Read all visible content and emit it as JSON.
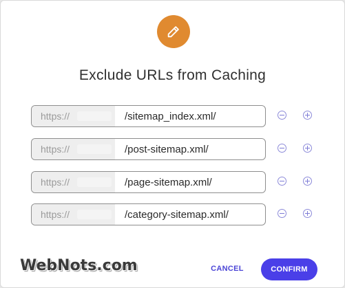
{
  "dialog": {
    "icon": "pencil-icon",
    "accent_color": "#e08a30",
    "title": "Exclude URLs from Caching"
  },
  "urls": [
    {
      "prefix": "https://",
      "path": "/sitemap_index.xml/"
    },
    {
      "prefix": "https://",
      "path": "/post-sitemap.xml/"
    },
    {
      "prefix": "https://",
      "path": "/page-sitemap.xml/"
    },
    {
      "prefix": "https://",
      "path": "/category-sitemap.xml/"
    }
  ],
  "row_actions": {
    "remove_icon": "minus-circle-icon",
    "add_icon": "plus-circle-icon",
    "icon_color": "#7c7ad6"
  },
  "footer": {
    "watermark": "WebNots.com",
    "cancel_label": "CANCEL",
    "confirm_label": "CONFIRM",
    "confirm_color": "#4a3fe8"
  }
}
